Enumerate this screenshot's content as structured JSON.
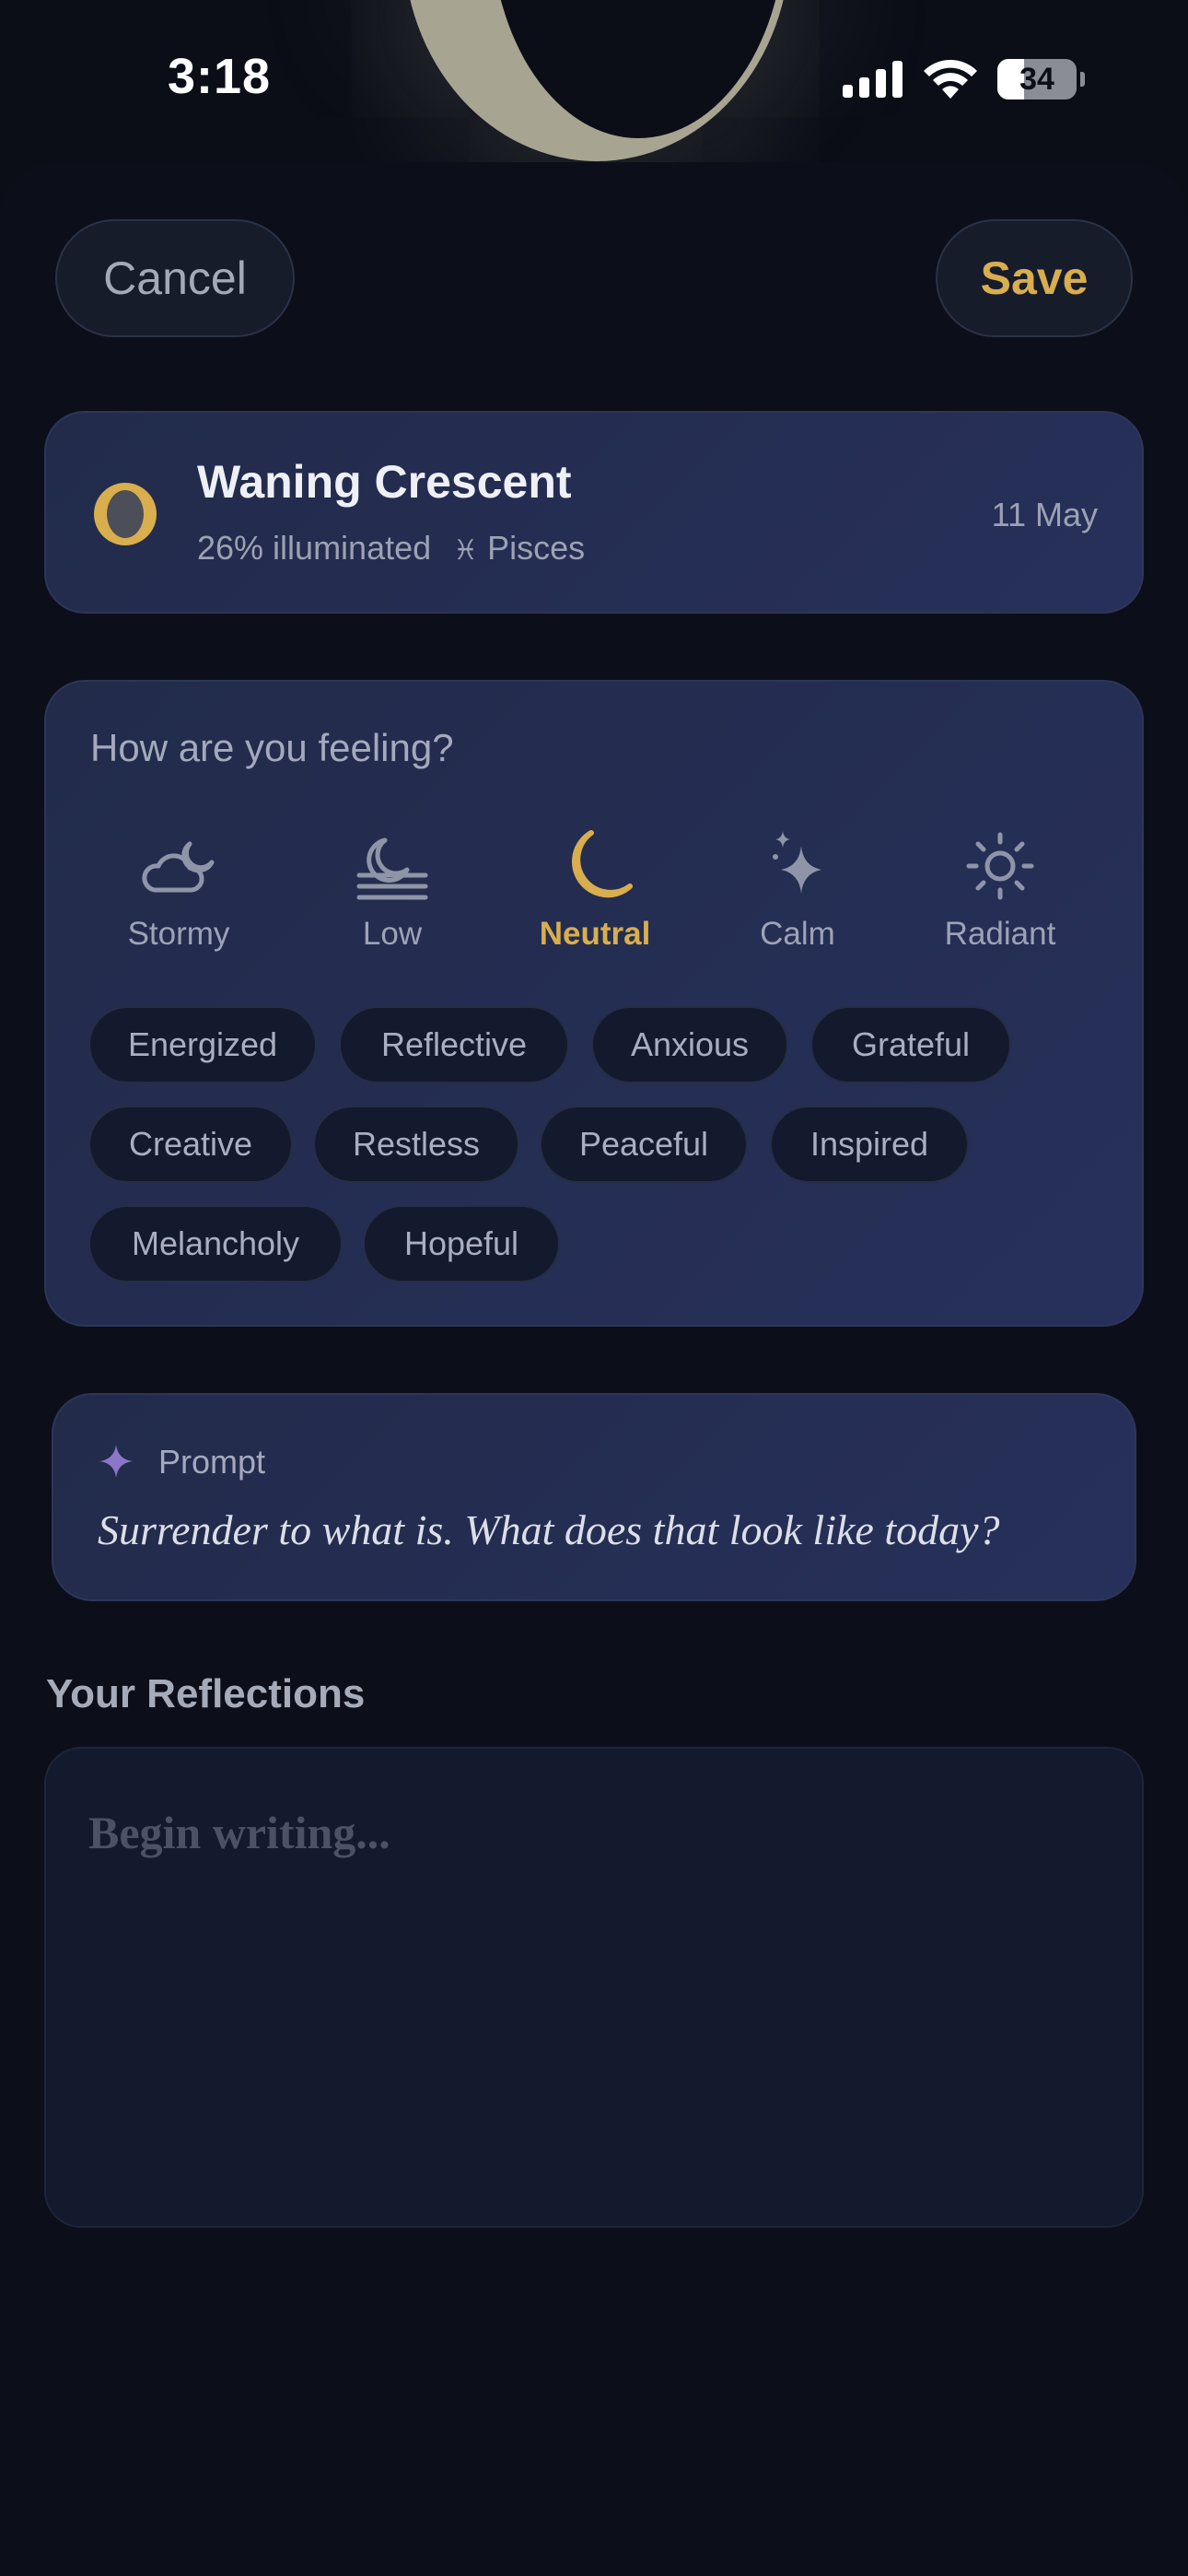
{
  "status_bar": {
    "time": "3:18",
    "battery": "34"
  },
  "header": {
    "cancel_label": "Cancel",
    "save_label": "Save"
  },
  "moon": {
    "phase": "Waning Crescent",
    "illumination": "26% illuminated",
    "zodiac_glyph": "♓",
    "zodiac": "Pisces",
    "date": "11 May",
    "accent": "#d8ae4e"
  },
  "mood": {
    "question": "How are you feeling?",
    "options": [
      {
        "label": "Stormy",
        "icon": "cloud-moon-icon"
      },
      {
        "label": "Low",
        "icon": "moon-fog-icon"
      },
      {
        "label": "Neutral",
        "icon": "crescent-moon-icon",
        "selected": true
      },
      {
        "label": "Calm",
        "icon": "sparkle-icon"
      },
      {
        "label": "Radiant",
        "icon": "sun-icon"
      }
    ],
    "tags": [
      "Energized",
      "Reflective",
      "Anxious",
      "Grateful",
      "Creative",
      "Restless",
      "Peaceful",
      "Inspired",
      "Melancholy",
      "Hopeful"
    ]
  },
  "prompt": {
    "label": "Prompt",
    "text": "Surrender to what is. What does that look like today?"
  },
  "reflections": {
    "title": "Your Reflections",
    "placeholder": "Begin writing..."
  }
}
